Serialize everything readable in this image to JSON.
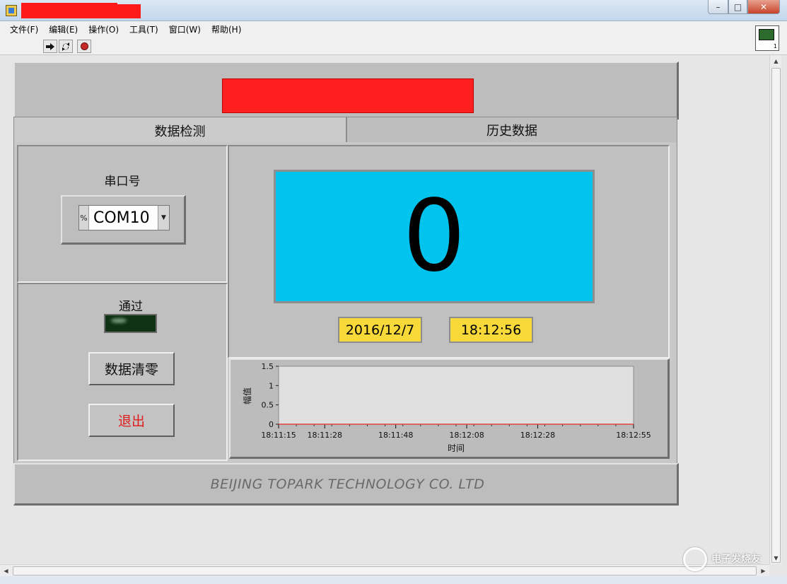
{
  "menu": {
    "items": [
      "文件(F)",
      "编辑(E)",
      "操作(O)",
      "工具(T)",
      "窗口(W)",
      "帮助(H)"
    ]
  },
  "tabs": {
    "active": "数据检测",
    "inactive": "历史数据"
  },
  "port": {
    "label": "串口号",
    "prefix": "%",
    "value": "COM10"
  },
  "indicator": {
    "label": "通过",
    "state": "off"
  },
  "buttons": {
    "clear": "数据清零",
    "exit": "退出"
  },
  "display": {
    "value": "0",
    "date": "2016/12/7",
    "time": "18:12:56"
  },
  "footer": {
    "company": "BEIJING TOPARK TECHNOLOGY CO. LTD"
  },
  "watermark": {
    "text": "电子发烧友"
  },
  "colors": {
    "numeric_bg": "#00c3ee",
    "date_bg": "#f7d93a",
    "redaction": "#ff1f1f",
    "exit_text": "#e01b1b",
    "plot_line": "#e04040"
  },
  "chart_data": {
    "type": "line",
    "xlabel": "时间",
    "ylabel": "幅值",
    "ylim": [
      0,
      1.5
    ],
    "yticks": [
      "1.5",
      "1",
      "0.5",
      "0"
    ],
    "xticks": [
      "18:11:15",
      "18:11:28",
      "18:11:48",
      "18:12:08",
      "18:12:28",
      "18:12:55"
    ],
    "series": [
      {
        "x": [
          "18:11:15",
          "18:12:55"
        ],
        "values": [
          0,
          0
        ]
      }
    ]
  }
}
